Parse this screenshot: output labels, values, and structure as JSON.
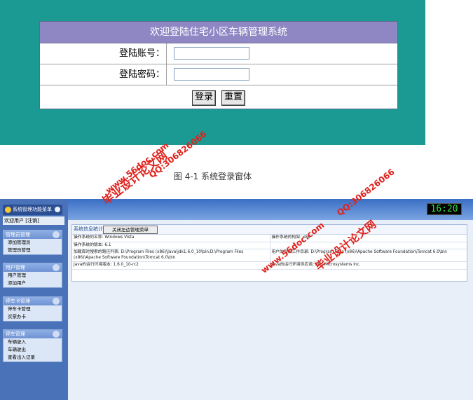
{
  "login": {
    "title": "欢迎登陆住宅小区车辆管理系统",
    "account_label": "登陆账号：",
    "password_label": "登陆密码：",
    "login_button": "登录",
    "reset_button": "重置"
  },
  "caption": "图 4-1 系统登录窗体",
  "admin": {
    "sidebar_title": "系统管理功能菜单",
    "user_bar": "欢迎用户  [注销]",
    "groups": [
      {
        "title": "管理员管理",
        "items": [
          "添加管理员",
          "管理员管理"
        ]
      },
      {
        "title": "用户管理",
        "items": [
          "用户管理",
          "添加用户"
        ]
      },
      {
        "title": "停车卡管理",
        "items": [
          "停车卡管理",
          "买票办卡"
        ]
      },
      {
        "title": "停车管理",
        "items": [
          "车辆驶入",
          "车辆驶出",
          "查看出入记录"
        ]
      }
    ],
    "clock": "16:20",
    "info_title": "系统信息统计",
    "close_menu_button": "关闭左边管理菜单",
    "info_rows": [
      [
        "操作系统的名称:  Windows Vista",
        "操作系统的构架:  x86"
      ],
      [
        "操作系统的版本:  6.1",
        ""
      ],
      [
        "加载库时搜索的路径列表:  D:\\Program Files (x86)\\Java\\jdk1.6.0_10\\bin;D:\\Program Files (x86)\\Apache Software Foundation\\Tomcat 6.0\\bin",
        "用户的当前工作目录:  D:\\Program Files (x86)\\Apache Software Foundation\\Tomcat 6.0\\bin"
      ],
      [
        "Java的运行环境版本:  1.6.0_10-rc2",
        "Java的运行环境供应商:  Sun Microsystems Inc."
      ]
    ]
  },
  "watermarks": {
    "site": "www.56doc.com",
    "brand": "毕业设计论文网",
    "qq": "QQ:306826066"
  }
}
